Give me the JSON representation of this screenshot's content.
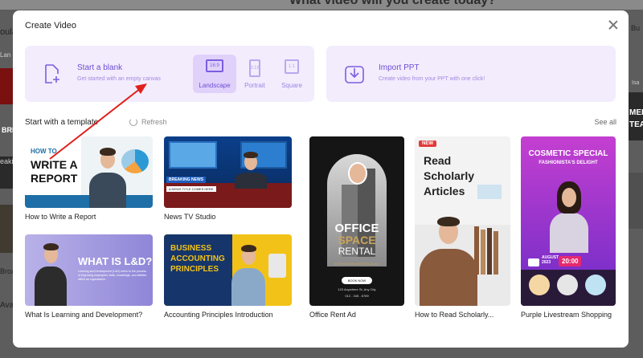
{
  "background": {
    "headline": "What video will you create today?",
    "left_labels": [
      "oula",
      "Lan",
      "BRE",
      "eaki",
      "Broa",
      "Ava"
    ],
    "right_labels": [
      "Bu",
      "Isa",
      "MEE",
      "TEA"
    ]
  },
  "modal": {
    "title": "Create Video",
    "blank": {
      "title": "Start a blank",
      "subtitle": "Get started with an empty canvas",
      "orientations": [
        {
          "label": "Landscape",
          "glyph": "16:9"
        },
        {
          "label": "Portrait",
          "glyph": "9:16"
        },
        {
          "label": "Square",
          "glyph": "1:1"
        }
      ]
    },
    "ppt": {
      "title": "Import PPT",
      "subtitle": "Create video from your PPT with one click!"
    },
    "section": {
      "title": "Start with a template",
      "refresh": "Refresh",
      "see_all": "See all"
    },
    "templates": [
      {
        "caption": "How to Write a Report",
        "t1": "HOW TO",
        "t2": "WRITE A",
        "t3": "REPORT"
      },
      {
        "caption": "News TV Studio",
        "t1": "BREAKING NEWS",
        "t2": "A NEWS TITLE COMES HERE"
      },
      {
        "caption": "What Is Learning and Development?",
        "t1": "WHAT IS L&D?",
        "t2": "Learning and Development (L&D) refers to the process of improving employees' skills, knowledge, and abilities within an organization."
      },
      {
        "caption": "Accounting Principles Introduction",
        "t1": "BUSINESS",
        "t2": "ACCOUNTING",
        "t3": "PRINCIPLES"
      },
      {
        "caption": "Office Rent Ad",
        "t1": "OFFICE",
        "t2": "SPACE",
        "t3": "RENTAL",
        "t4": "EXTRAORDINARY DISCOUNT",
        "t5": "BOOK NOW",
        "t6": "123 Anywhere St, Any City",
        "t7": "012 - 345 - 6789"
      },
      {
        "caption": "How to Read Scholarly...",
        "badge": "NEW",
        "t1": "Read",
        "t2": "Scholarly",
        "t3": "Articles"
      },
      {
        "caption": "Purple Livestream Shopping",
        "t1": "COSMETIC SPECIAL",
        "t2": "FASHIONISTA'S DELIGHT",
        "t3": "AUGUST 2023",
        "t4": "20:00"
      }
    ]
  },
  "colors": {
    "accent": "#6b4fd4",
    "card_bg": "#f3ecfd",
    "arrow": "#e0201a"
  }
}
